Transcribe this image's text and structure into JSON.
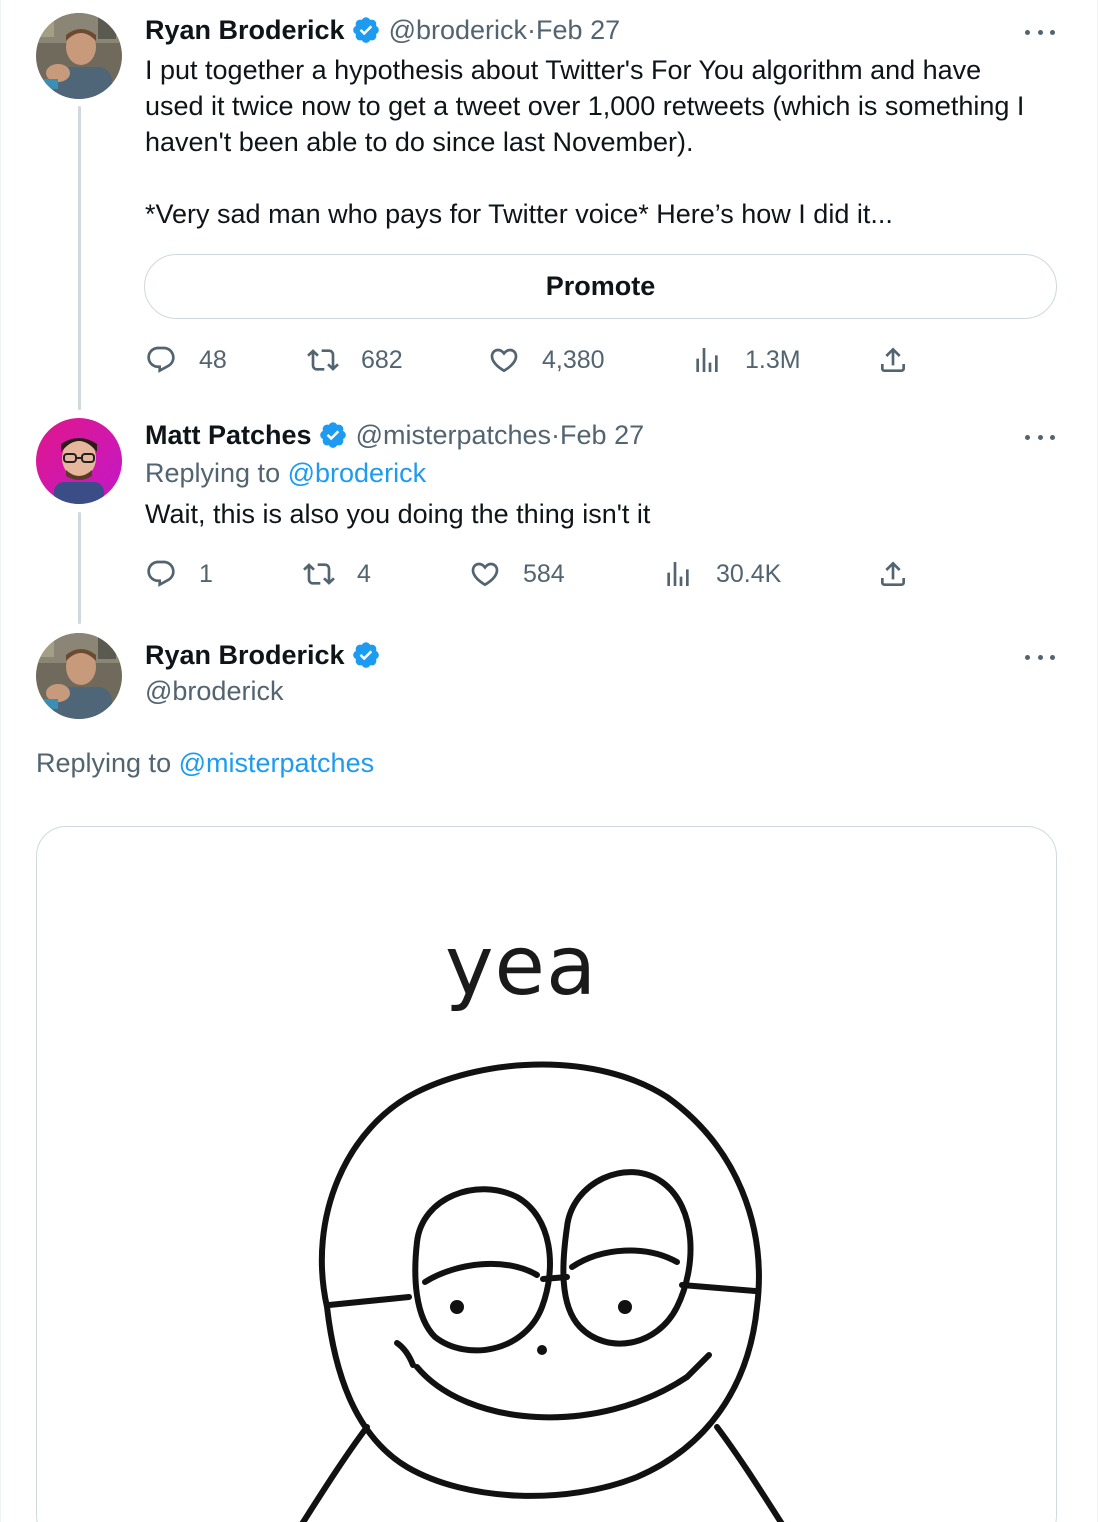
{
  "tweets": [
    {
      "display_name": "Ryan Broderick",
      "handle": "@broderick",
      "date": "Feb 27",
      "text_lines": [
        "I put together a hypothesis about Twitter's For You algorithm and have",
        "used it twice now to get a tweet over 1,000 retweets (which is something I",
        "haven't been able to do since last November).",
        "*Very sad man who pays for Twitter voice* Here’s how I did it..."
      ],
      "promote_label": "Promote",
      "stats": {
        "replies": "48",
        "retweets": "682",
        "likes": "4,380",
        "views": "1.3M"
      }
    },
    {
      "display_name": "Matt Patches",
      "handle": "@misterpatches",
      "date": "Feb 27",
      "replying_prefix": "Replying to",
      "replying_to": "@broderick",
      "text": "Wait, this is also you doing the thing isn't it",
      "stats": {
        "replies": "1",
        "retweets": "4",
        "likes": "584",
        "views": "30.4K"
      }
    },
    {
      "display_name": "Ryan Broderick",
      "handle": "@broderick",
      "replying_prefix": "Replying to",
      "replying_to": "@misterpatches",
      "media": {
        "caption": "yea"
      }
    }
  ],
  "date_separator": " · ",
  "colors": {
    "verified": "#1d9bf0",
    "link": "#1d9bf0",
    "muted": "#536471",
    "thread_line": "#cfd9de",
    "border": "#cfd9de"
  },
  "icons": [
    "verified-badge-icon",
    "reply-icon",
    "retweet-icon",
    "like-icon",
    "views-icon",
    "share-icon",
    "more-icon"
  ]
}
